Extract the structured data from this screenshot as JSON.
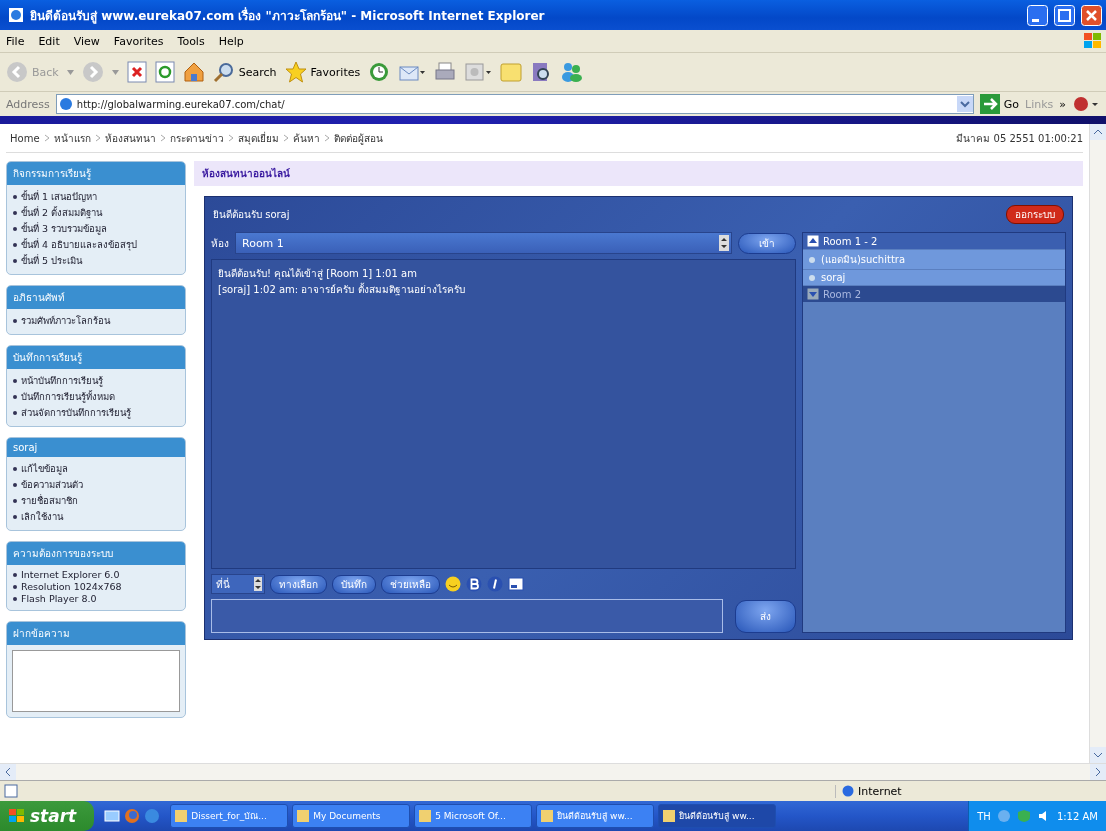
{
  "window": {
    "title": "ยินดีต้อนรับสู่ www.eureka07.com เรื่อง \"ภาวะโลกร้อน\" - Microsoft Internet Explorer"
  },
  "menu": [
    "File",
    "Edit",
    "View",
    "Favorites",
    "Tools",
    "Help"
  ],
  "toolbar": {
    "back": "Back",
    "search": "Search",
    "favorites": "Favorites"
  },
  "address": {
    "label": "Address",
    "value": "http://globalwarming.eureka07.com/chat/",
    "go": "Go",
    "links": "Links",
    "links_more": "»"
  },
  "page": {
    "breadcrumbs": [
      "Home",
      "หน้าแรก",
      "ห้องสนทนา",
      "กระดานข่าว",
      "สมุดเยี่ยม",
      "ค้นหา",
      "ติดต่อผู้สอน"
    ],
    "date": "มีนาคม 05 2551 01:00:21",
    "sidebar": [
      {
        "kind": "list",
        "title": "กิจกรรมการเรียนรู้",
        "items": [
          "ขั้นที่ 1 เสนอปัญหา",
          "ขั้นที่ 2 ตั้งสมมติฐาน",
          "ขั้นที่ 3 รวบรวมข้อมูล",
          "ขั้นที่ 4 อธิบายและลงข้อสรุป",
          "ขั้นที่ 5 ประเมิน"
        ]
      },
      {
        "kind": "list",
        "title": "อภิธานศัพท์",
        "items": [
          "รวมศัพท์ภาวะโลกร้อน"
        ]
      },
      {
        "kind": "list",
        "title": "บันทึกการเรียนรู้",
        "items": [
          "หน้าบันทึกการเรียนรู้",
          "บันทึกการเรียนรู้ทั้งหมด",
          "ส่วนจัดการบันทึกการเรียนรู้"
        ]
      },
      {
        "kind": "list",
        "title": "soraj",
        "items": [
          "แก้ไขข้อมูล",
          "ข้อความส่วนตัว",
          "รายชื่อสมาชิก",
          "เลิกใช้งาน"
        ]
      },
      {
        "kind": "list",
        "title": "ความต้องการของระบบ",
        "items": [
          "Internet Explorer 6.0",
          "Resolution 1024x768",
          "Flash Player 8.0"
        ]
      },
      {
        "kind": "note",
        "title": "ฝากข้อความ"
      }
    ],
    "heading": "ห้องสนทนาออนไลน์",
    "chat": {
      "welcome": "ยินดีต้อนรับ soraj",
      "logout": "ออกระบบ",
      "room_label": "ห้อง",
      "room": "Room 1",
      "enter": "เข้า",
      "messages": [
        "ยินดีต้อนรับ! คุณได้เข้าสู่ [Room 1] 1:01 am",
        "[soraj] 1:02 am: อาจารย์ครับ ตั้งสมมติฐานอย่างไรครับ"
      ],
      "rooms": [
        {
          "label": "Room 1 - 2",
          "expanded": true,
          "users": [
            "(แอดมิน)suchittra",
            "soraj"
          ]
        },
        {
          "label": "Room 2",
          "expanded": false
        }
      ],
      "size_label": "ที่นี่",
      "buttons": [
        "ทางเลือก",
        "บันทึก",
        "ช่วยเหลือ"
      ],
      "send": "ส่ง"
    }
  },
  "status_bar": {
    "zone": "Internet"
  },
  "taskbar": {
    "start": "start",
    "tasks": [
      {
        "label": "Dissert_for_บัณ...",
        "selected": false
      },
      {
        "label": "My Documents",
        "selected": false
      },
      {
        "label": "5 Microsoft Of...",
        "selected": false
      },
      {
        "label": "ยินดีต้อนรับสู่ ww...",
        "selected": false
      },
      {
        "label": "ยินดีต้อนรับสู่ ww...",
        "selected": true
      }
    ],
    "language": "TH",
    "clock": "1:12 AM"
  }
}
